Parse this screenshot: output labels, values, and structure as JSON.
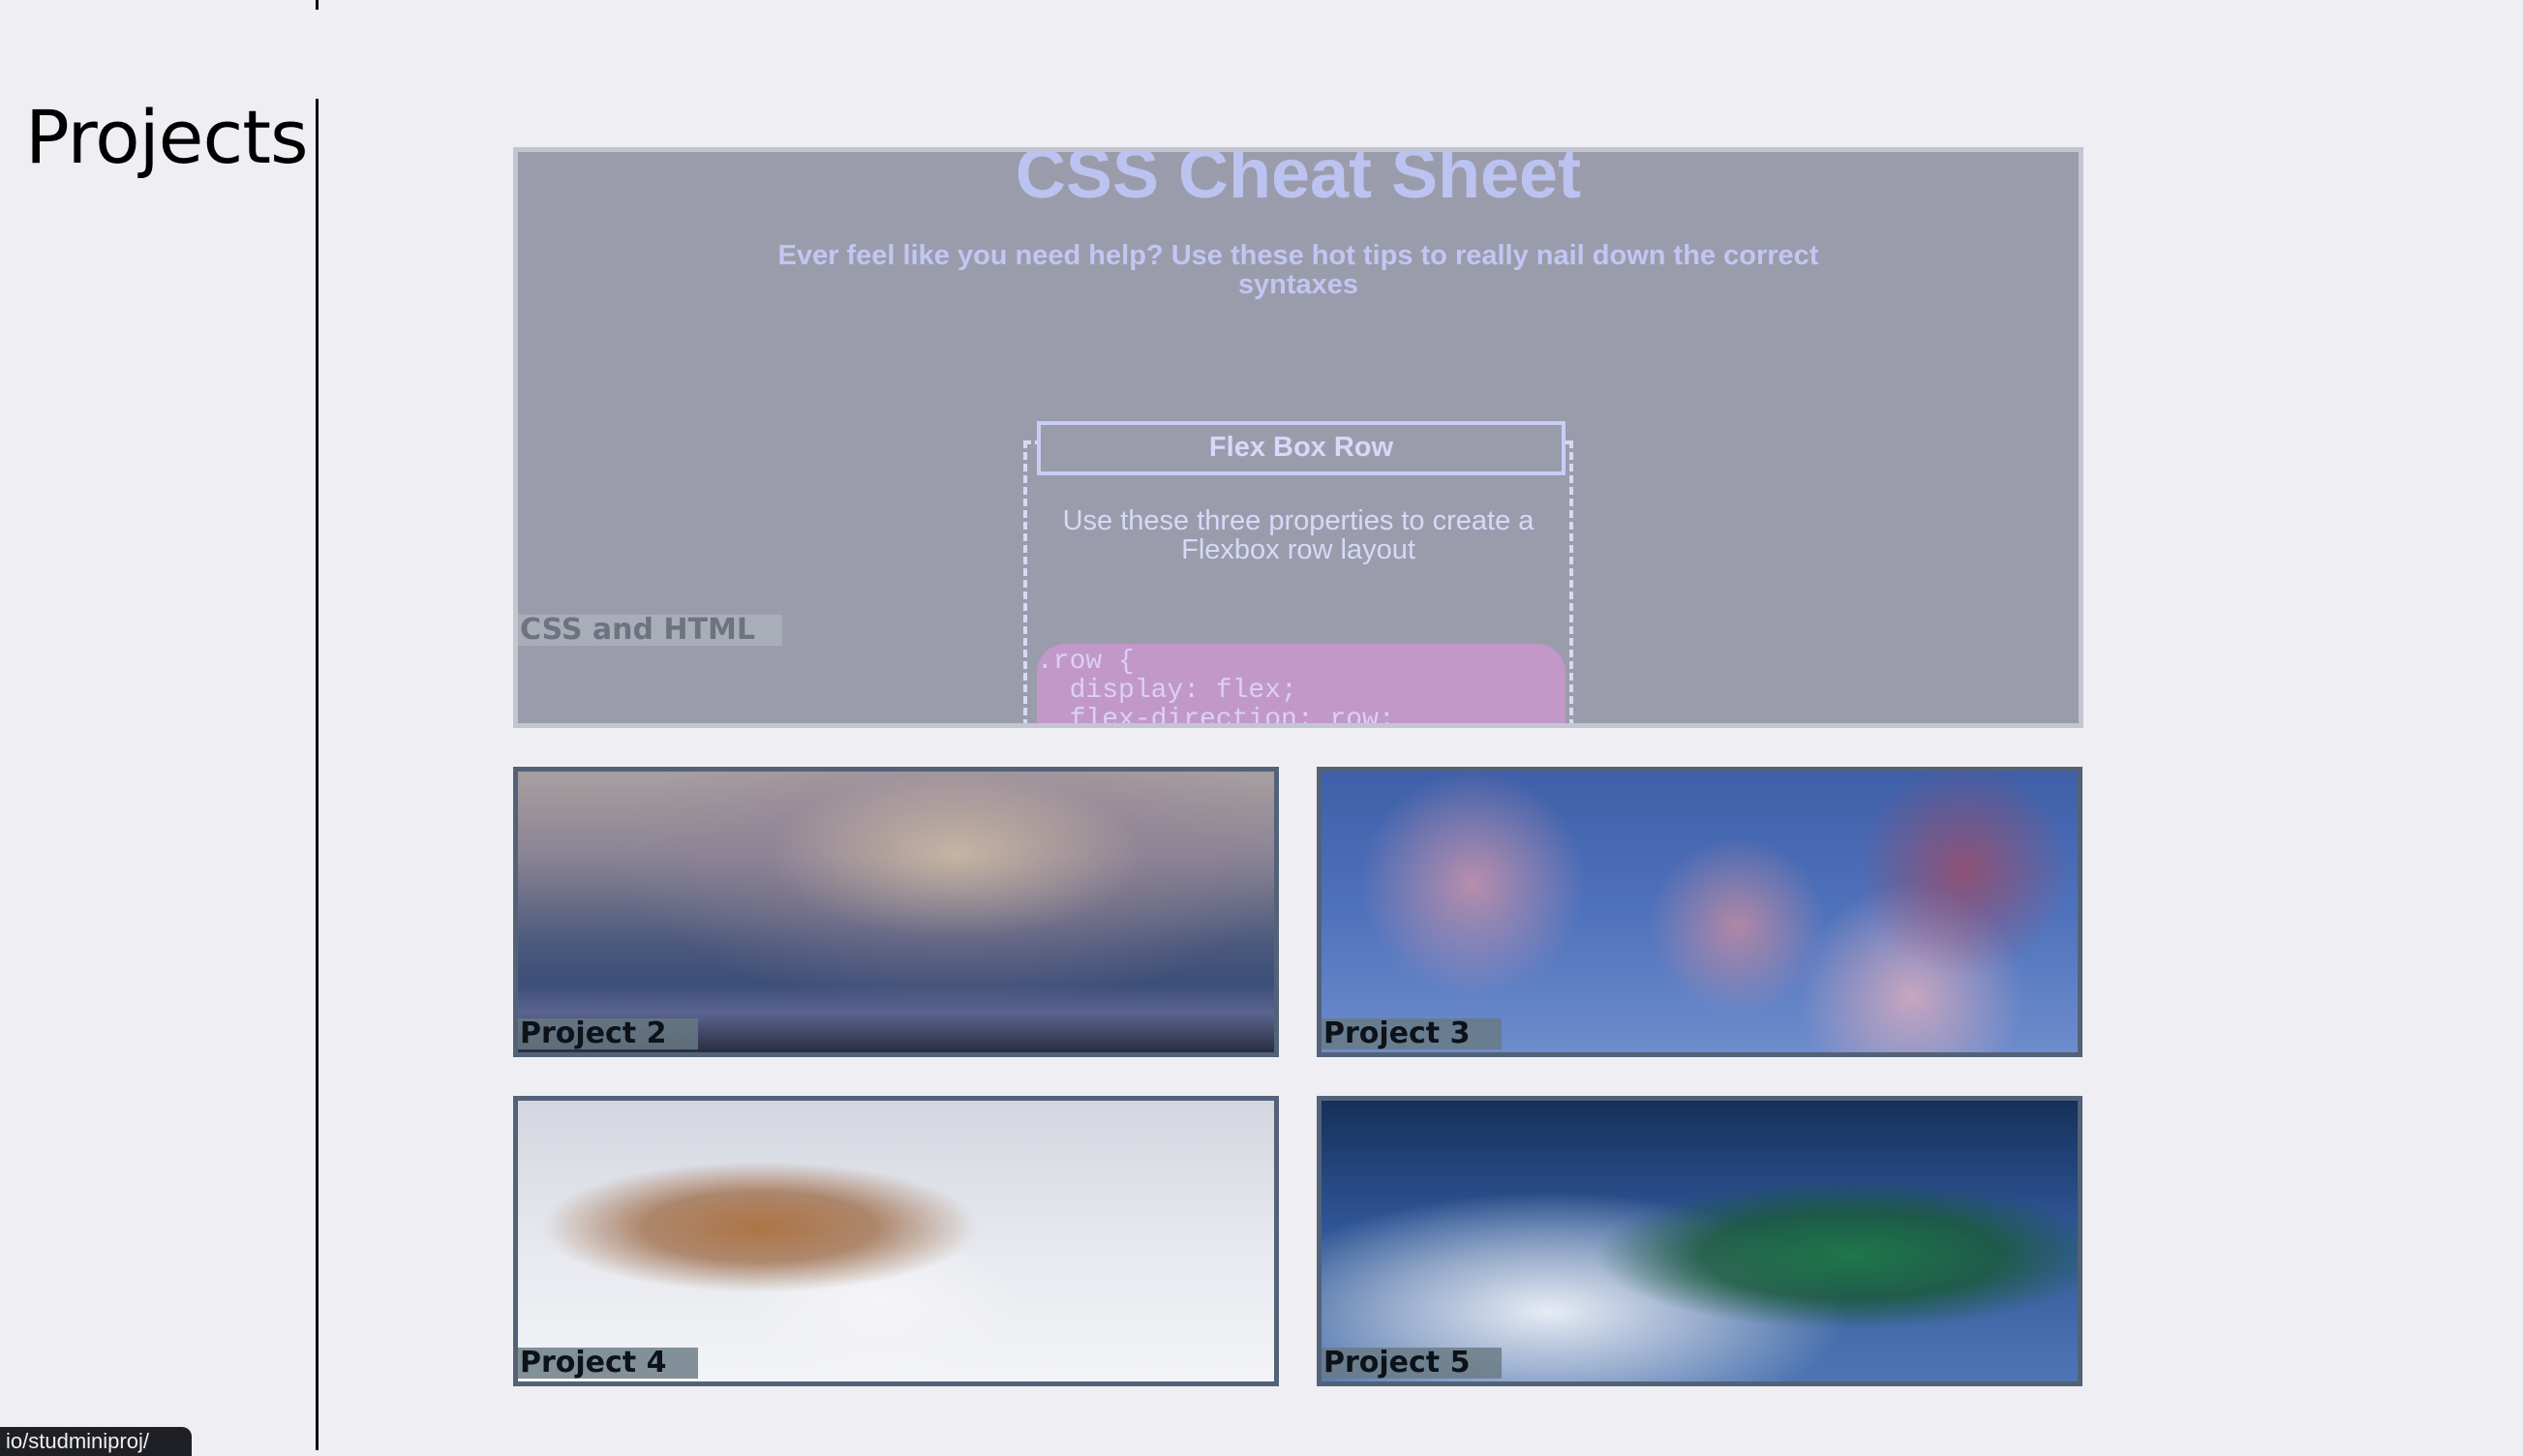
{
  "page": {
    "section_title": "Projects",
    "status_url": "io/studminiproj/"
  },
  "featured_project": {
    "caption": "CSS and HTML",
    "preview": {
      "title": "CSS Cheat Sheet",
      "subtitle": "Ever feel like you need help? Use these hot tips to really nail down the correct syntaxes",
      "card": {
        "heading": "Flex Box Row",
        "description": "Use these three properties to create a Flexbox row layout",
        "code": ".row {\n  display: flex;\n  flex-direction: row;"
      }
    }
  },
  "projects": [
    {
      "caption": "Project 2",
      "image": "night-sky-milky-way"
    },
    {
      "caption": "Project 3",
      "image": "cherry-blossom-branches"
    },
    {
      "caption": "Project 4",
      "image": "puppy-in-snow"
    },
    {
      "caption": "Project 5",
      "image": "mountaineer-on-snowy-peak"
    }
  ]
}
